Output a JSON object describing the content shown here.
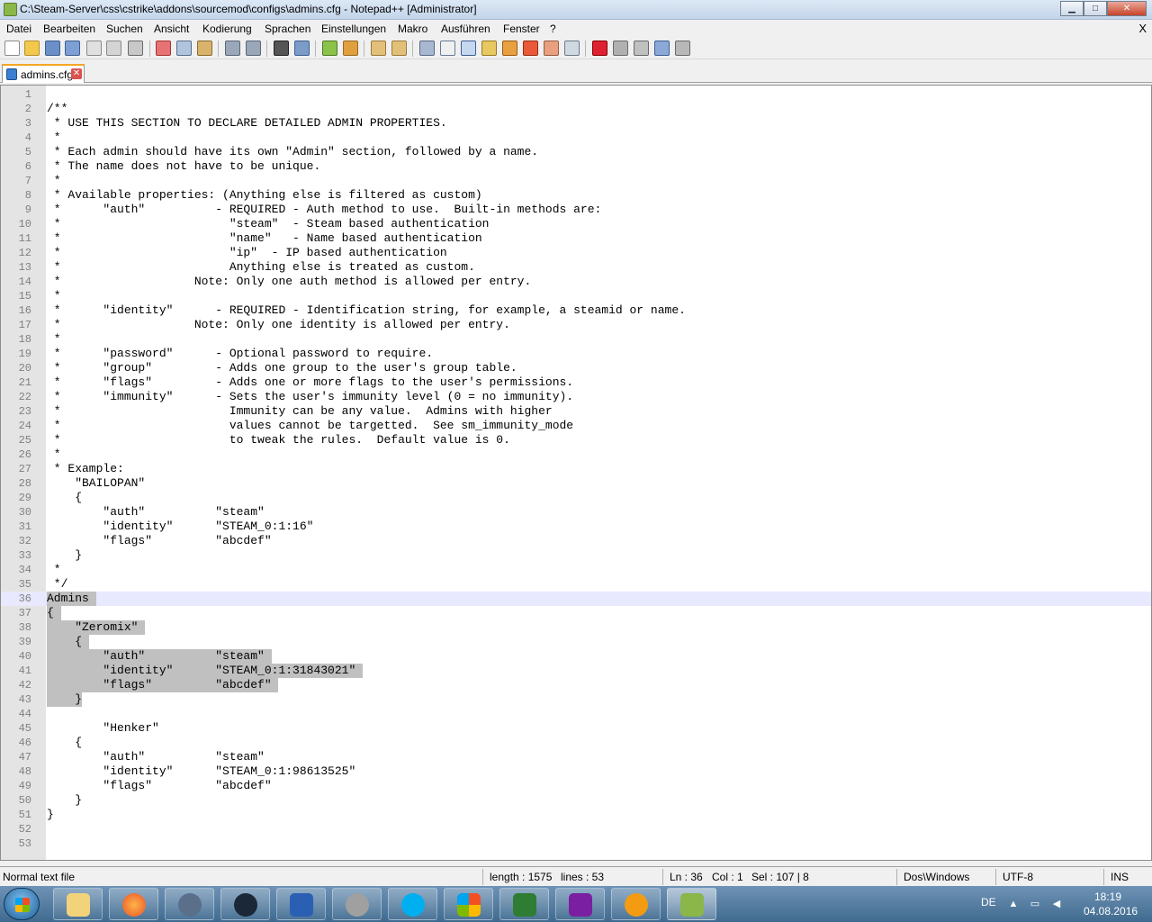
{
  "window": {
    "title": "C:\\Steam-Server\\css\\cstrike\\addons\\sourcemod\\configs\\admins.cfg - Notepad++ [Administrator]",
    "minimize": "▁",
    "maximize": "□",
    "close": "✕"
  },
  "menu": {
    "items": [
      "Datei",
      "Bearbeiten",
      "Suchen",
      "Ansicht",
      "Kodierung",
      "Sprachen",
      "Einstellungen",
      "Makro",
      "Ausführen",
      "Fenster",
      "?"
    ],
    "close_label": "X"
  },
  "toolbar": {
    "icons": [
      "new-file-icon",
      "open-file-icon",
      "save-icon",
      "save-all-icon",
      "close-icon",
      "close-all-icon",
      "print-icon",
      "cut-icon",
      "copy-icon",
      "paste-icon",
      "undo-icon",
      "redo-icon",
      "find-icon",
      "replace-icon",
      "zoom-in-icon",
      "zoom-out-icon",
      "sync-vertical-icon",
      "sync-horizontal-icon",
      "word-wrap-icon",
      "show-all-chars-icon",
      "indent-guide-icon",
      "doc-map-icon",
      "function-list-icon",
      "folder-workspace-icon",
      "monitoring-icon",
      "record-macro-icon",
      "stop-macro-icon",
      "play-macro-icon",
      "run-macro-multiple-icon",
      "save-macro-icon"
    ]
  },
  "tab": {
    "label": "admins.cfg",
    "close": "✕"
  },
  "editor": {
    "current_line": 36,
    "lines": [
      {
        "n": "1",
        "text": ""
      },
      {
        "n": "2",
        "text": "/**"
      },
      {
        "n": "3",
        "text": " * USE THIS SECTION TO DECLARE DETAILED ADMIN PROPERTIES."
      },
      {
        "n": "4",
        "text": " *"
      },
      {
        "n": "5",
        "text": " * Each admin should have its own \"Admin\" section, followed by a name."
      },
      {
        "n": "6",
        "text": " * The name does not have to be unique."
      },
      {
        "n": "7",
        "text": " *"
      },
      {
        "n": "8",
        "text": " * Available properties: (Anything else is filtered as custom)"
      },
      {
        "n": "9",
        "text": " *      \"auth\"          - REQUIRED - Auth method to use.  Built-in methods are:"
      },
      {
        "n": "10",
        "text": " *                        \"steam\"  - Steam based authentication"
      },
      {
        "n": "11",
        "text": " *                        \"name\"   - Name based authentication"
      },
      {
        "n": "12",
        "text": " *                        \"ip\"  - IP based authentication"
      },
      {
        "n": "13",
        "text": " *                        Anything else is treated as custom."
      },
      {
        "n": "14",
        "text": " *                   Note: Only one auth method is allowed per entry."
      },
      {
        "n": "15",
        "text": " *"
      },
      {
        "n": "16",
        "text": " *      \"identity\"      - REQUIRED - Identification string, for example, a steamid or name."
      },
      {
        "n": "17",
        "text": " *                   Note: Only one identity is allowed per entry."
      },
      {
        "n": "18",
        "text": " *"
      },
      {
        "n": "19",
        "text": " *      \"password\"      - Optional password to require."
      },
      {
        "n": "20",
        "text": " *      \"group\"         - Adds one group to the user's group table."
      },
      {
        "n": "21",
        "text": " *      \"flags\"         - Adds one or more flags to the user's permissions."
      },
      {
        "n": "22",
        "text": " *      \"immunity\"      - Sets the user's immunity level (0 = no immunity)."
      },
      {
        "n": "23",
        "text": " *                        Immunity can be any value.  Admins with higher"
      },
      {
        "n": "24",
        "text": " *                        values cannot be targetted.  See sm_immunity_mode"
      },
      {
        "n": "25",
        "text": " *                        to tweak the rules.  Default value is 0."
      },
      {
        "n": "26",
        "text": " *"
      },
      {
        "n": "27",
        "text": " * Example:"
      },
      {
        "n": "28",
        "text": "    \"BAILOPAN\""
      },
      {
        "n": "29",
        "text": "    {"
      },
      {
        "n": "30",
        "text": "        \"auth\"          \"steam\""
      },
      {
        "n": "31",
        "text": "        \"identity\"      \"STEAM_0:1:16\""
      },
      {
        "n": "32",
        "text": "        \"flags\"         \"abcdef\""
      },
      {
        "n": "33",
        "text": "    }"
      },
      {
        "n": "34",
        "text": " *"
      },
      {
        "n": "35",
        "text": " */"
      },
      {
        "n": "36",
        "text": "Admins ",
        "selected": true
      },
      {
        "n": "37",
        "text": "{ ",
        "selected": true
      },
      {
        "n": "38",
        "text": "    \"Zeromix\" ",
        "selected": true
      },
      {
        "n": "39",
        "text": "    { ",
        "selected": true
      },
      {
        "n": "40",
        "text": "        \"auth\"          \"steam\" ",
        "selected": true
      },
      {
        "n": "41",
        "text": "        \"identity\"      \"STEAM_0:1:31843021\" ",
        "selected": true
      },
      {
        "n": "42",
        "text": "        \"flags\"         \"abcdef\" ",
        "selected": true
      },
      {
        "n": "43",
        "text": "    }",
        "selected": true
      },
      {
        "n": "44",
        "text": ""
      },
      {
        "n": "45",
        "text": "        \"Henker\""
      },
      {
        "n": "46",
        "text": "    {"
      },
      {
        "n": "47",
        "text": "        \"auth\"          \"steam\""
      },
      {
        "n": "48",
        "text": "        \"identity\"      \"STEAM_0:1:98613525\""
      },
      {
        "n": "49",
        "text": "        \"flags\"         \"abcdef\""
      },
      {
        "n": "50",
        "text": "    }"
      },
      {
        "n": "51",
        "text": "}"
      },
      {
        "n": "52",
        "text": ""
      },
      {
        "n": "53",
        "text": ""
      }
    ]
  },
  "status": {
    "file_type": "Normal text file",
    "length": "length : 1575",
    "lines": "lines : 53",
    "ln": "Ln : 36",
    "col": "Col : 1",
    "sel": "Sel : 107 | 8",
    "eol": "Dos\\Windows",
    "encoding": "UTF-8",
    "mode": "INS"
  },
  "taskbar": {
    "apps": [
      "explorer-icon",
      "firefox-icon",
      "teamspeak-icon",
      "steam-icon",
      "word-icon",
      "speaker-app-icon",
      "skype-icon",
      "windows-manager-icon",
      "task-manager-icon",
      "winrar-icon",
      "half-life-icon",
      "notepadpp-icon"
    ],
    "language": "DE",
    "time": "18:19",
    "date": "04.08.2016",
    "colors": {
      "accent": "#3f6a8f"
    }
  }
}
